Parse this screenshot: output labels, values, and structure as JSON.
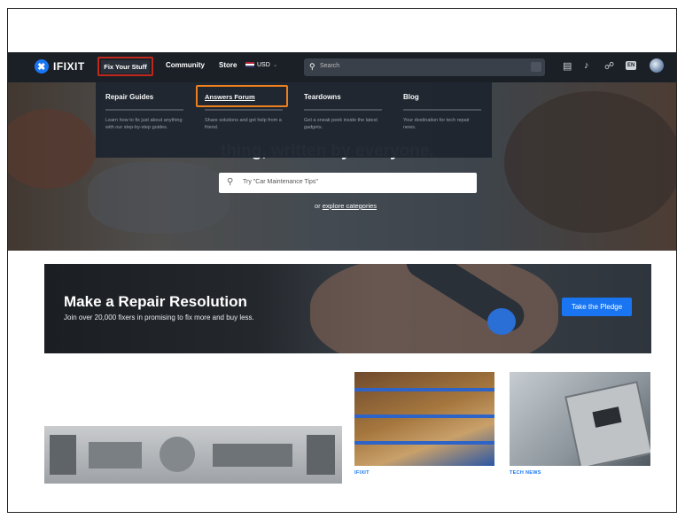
{
  "nav": {
    "logo": "IFIXIT",
    "fix_your_stuff": "Fix Your Stuff",
    "community": "Community",
    "store": "Store",
    "currency": "USD",
    "search_placeholder": "Search",
    "language": "EN",
    "icons": [
      "toolbox-icon",
      "bell-icon",
      "cart-icon"
    ]
  },
  "dropdown": {
    "columns": [
      {
        "title": "Repair Guides",
        "desc": "Learn how to fix just about anything with our step-by-step guides."
      },
      {
        "title": "Answers Forum",
        "desc": "Share solutions and get help from a friend."
      },
      {
        "title": "Teardowns",
        "desc": "Get a sneak peek inside the latest gadgets."
      },
      {
        "title": "Blog",
        "desc": "Your destination for tech repair news."
      }
    ]
  },
  "hero": {
    "title": "thing, written by everyone.",
    "search_placeholder": "Try \"Car Maintenance Tips\"",
    "or_text": "or",
    "explore_link": "explore categories"
  },
  "banner": {
    "title": "Make a Repair Resolution",
    "subtitle": "Join over 20,000 fixers in promising to fix more and buy less.",
    "button": "Take the Pledge"
  },
  "cards": [
    {
      "label": ""
    },
    {
      "label": "IFIXIT"
    },
    {
      "label": "TECH NEWS"
    }
  ],
  "colors": {
    "nav_bg": "#1b2027",
    "accent_blue": "#1975f2",
    "highlight_red": "#c0281c",
    "highlight_orange": "#f2811d"
  }
}
